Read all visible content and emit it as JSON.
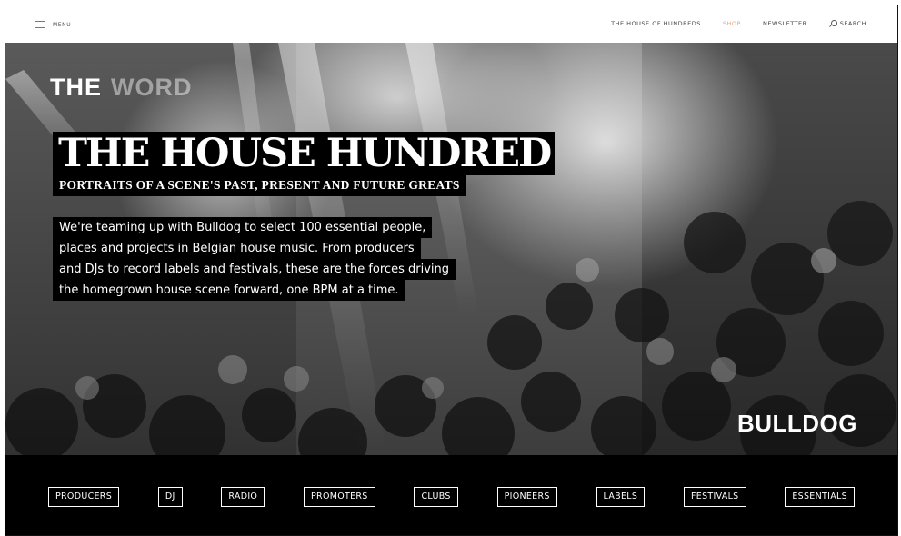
{
  "nav": {
    "menu_label": "MENU",
    "links": {
      "house": "THE HOUSE OF HUNDREDS",
      "shop": "SHOP",
      "newsletter": "NEWSLETTER",
      "search": "SEARCH"
    },
    "accent_color": "#e9a173"
  },
  "hero": {
    "eyebrow_part1": "THE",
    "eyebrow_part2": "WORD",
    "title": "THE HOUSE HUNDRED",
    "subtitle": "PORTRAITS OF A SCENE'S PAST, PRESENT AND FUTURE GREATS",
    "intro_lines": [
      "We're teaming up with Bulldog to select 100 essential people,",
      "places and projects in Belgian house music. From producers",
      "and DJs to record labels and festivals, these are the forces driving",
      "the homegrown house scene forward, one BPM at a time."
    ],
    "sponsor": "BULLDOG",
    "image_description": "black-and-white crowd photo"
  },
  "categories": [
    "PRODUCERS",
    "DJ",
    "RADIO",
    "PROMOTERS",
    "CLUBS",
    "PIONEERS",
    "LABELS",
    "FESTIVALS",
    "ESSENTIALS"
  ]
}
